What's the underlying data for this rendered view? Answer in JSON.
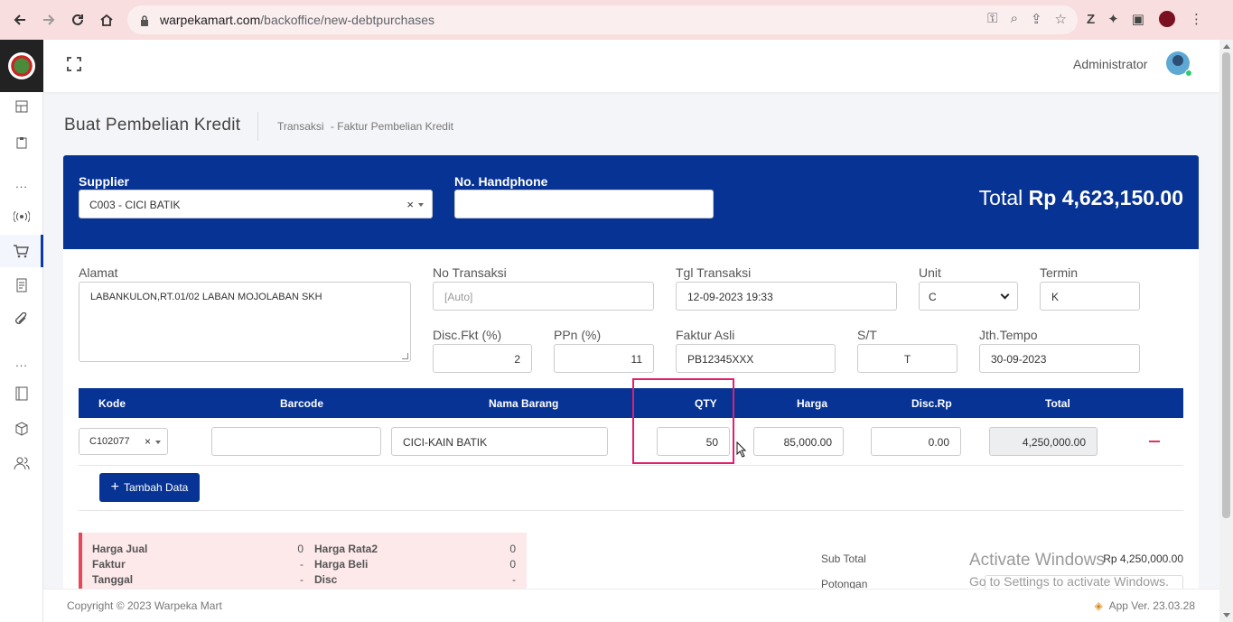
{
  "browser": {
    "url_host": "warpekamart.com",
    "url_path": "/backoffice/new-debtpurchases"
  },
  "topbar": {
    "user_name": "Administrator"
  },
  "page": {
    "title": "Buat Pembelian Kredit",
    "breadcrumb": [
      "Transaksi",
      "- Faktur Pembelian Kredit"
    ]
  },
  "header": {
    "supplier_label": "Supplier",
    "supplier_value": "C003 - CICI BATIK",
    "supplier_clear": "×",
    "phone_label": "No. Handphone",
    "phone_value": "",
    "total_prefix": "Total",
    "total_value": "Rp 4,623,150.00"
  },
  "form": {
    "alamat_label": "Alamat",
    "alamat_value": "LABANKULON,RT.01/02 LABAN MOJOLABAN SKH",
    "no_transaksi_label": "No Transaksi",
    "no_transaksi_placeholder": "[Auto]",
    "tgl_label": "Tgl Transaksi",
    "tgl_value": "12-09-2023 19:33",
    "unit_label": "Unit",
    "unit_value": "C",
    "termin_label": "Termin",
    "termin_value": "K",
    "disc_fkt_label": "Disc.Fkt (%)",
    "disc_fkt_value": "2",
    "ppn_label": "PPn (%)",
    "ppn_value": "11",
    "faktur_asli_label": "Faktur Asli",
    "faktur_asli_value": "PB12345XXX",
    "st_label": "S/T",
    "st_value": "T",
    "jth_tempo_label": "Jth.Tempo",
    "jth_tempo_value": "30-09-2023"
  },
  "table": {
    "headers": [
      "Kode",
      "Barcode",
      "Nama Barang",
      "QTY",
      "Harga",
      "Disc.Rp",
      "Total"
    ],
    "rows": [
      {
        "kode": "C102077",
        "kode_clear": "×",
        "barcode": "",
        "nama": "CICI-KAIN BATIK",
        "qty": "50",
        "harga": "85,000.00",
        "disc": "0.00",
        "total": "4,250,000.00"
      }
    ],
    "add_button": "Tambah Data"
  },
  "info": {
    "harga_jual_label": "Harga Jual",
    "harga_jual_value": "0",
    "faktur_label": "Faktur",
    "faktur_value": "-",
    "tanggal_label": "Tanggal",
    "tanggal_value": "-",
    "harga_rata_label": "Harga Rata2",
    "harga_rata_value": "0",
    "harga_beli_label": "Harga Beli",
    "harga_beli_value": "0",
    "disc_label": "Disc",
    "disc_value": "-"
  },
  "summary": {
    "subtotal_label": "Sub Total",
    "subtotal_value": "Rp 4,250,000.00",
    "potongan_label": "Potongan"
  },
  "watermark": {
    "line1": "Activate Windows",
    "line2": "Go to Settings to activate Windows."
  },
  "footer": {
    "copyright": "Copyright © 2023 Warpeka Mart",
    "version": "App Ver. 23.03.28"
  },
  "colors": {
    "primary": "#063394",
    "highlight": "#e0206e",
    "danger": "#e8465a",
    "chrome": "#f8dede"
  }
}
